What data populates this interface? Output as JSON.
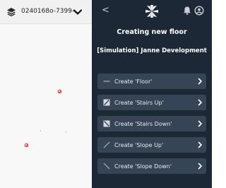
{
  "map": {
    "floor_selector_value": "0240168o-7399-..."
  },
  "panel": {
    "back_glyph": "<",
    "title": "Creating new floor",
    "subtitle": "[Simulation] Janne Development",
    "actions": [
      {
        "label": "Create 'Floor'",
        "icon": "floor-line-icon"
      },
      {
        "label": "Create 'Stairs Up'",
        "icon": "stairs-up-icon"
      },
      {
        "label": "Create 'Stairs Down'",
        "icon": "stairs-down-icon"
      },
      {
        "label": "Create 'Slope Up'",
        "icon": "slope-up-icon"
      },
      {
        "label": "Create 'Slope Down'",
        "icon": "slope-down-icon"
      }
    ]
  },
  "colors": {
    "panel_bg": "#1c2836",
    "button_bg": "#364456",
    "marker": "#e8484f"
  }
}
